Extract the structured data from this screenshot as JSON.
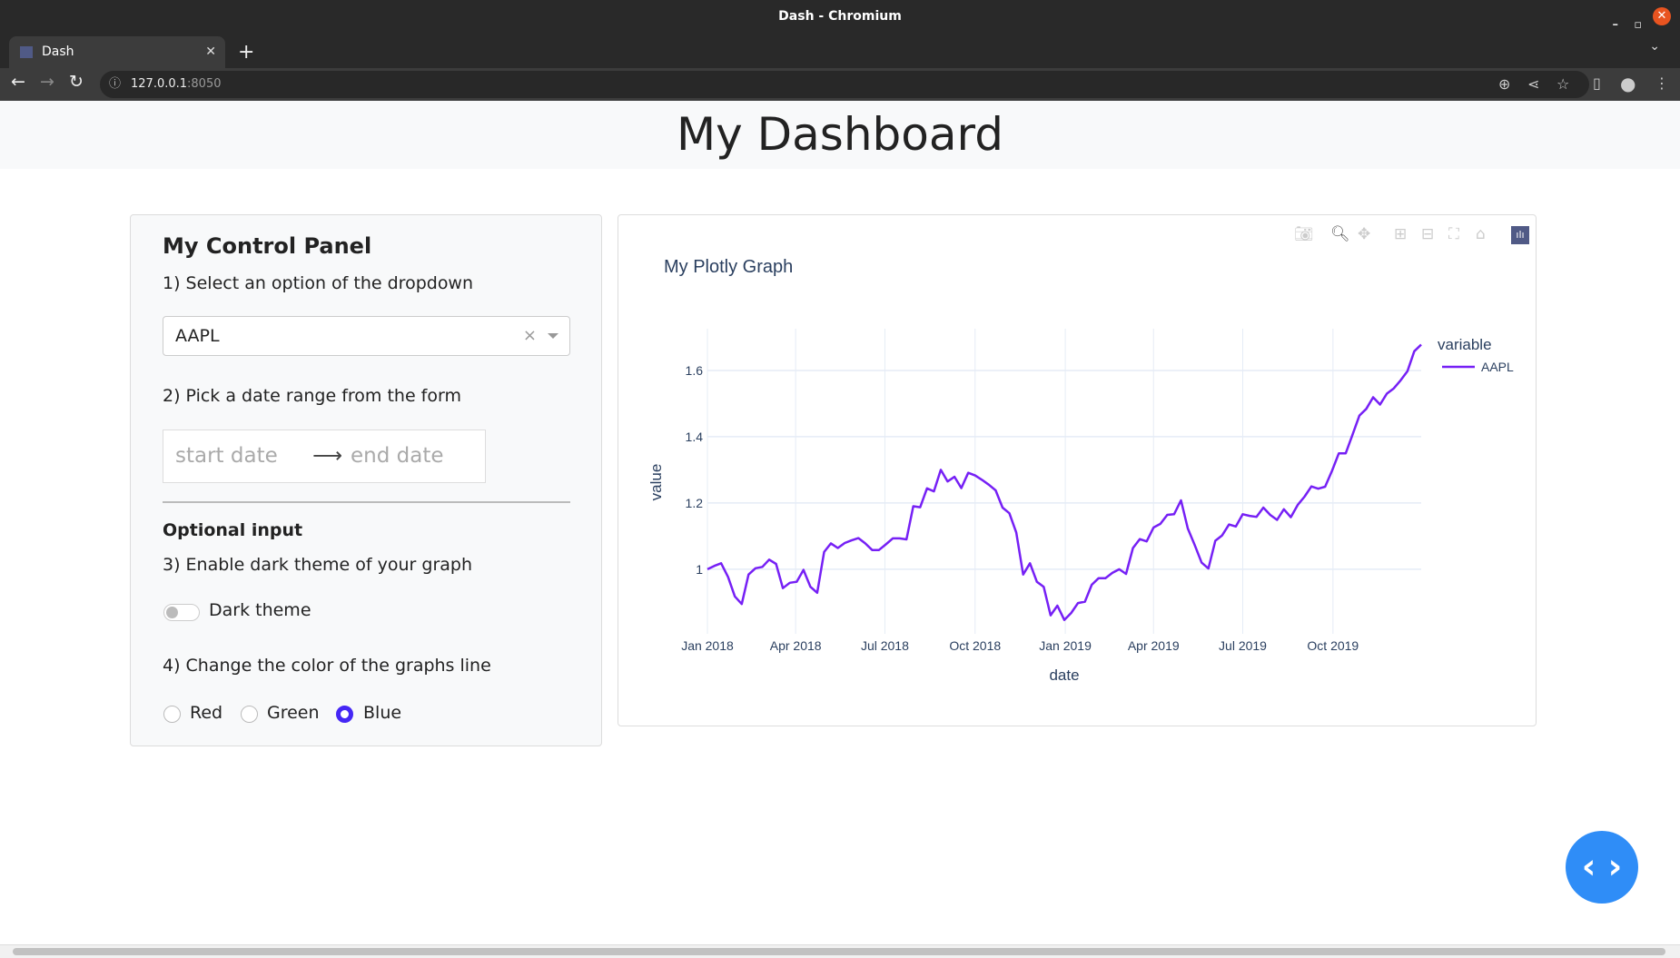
{
  "window": {
    "title": "Dash - Chromium",
    "tab_label": "Dash",
    "url_host": "127.0.0.1",
    "url_port": ":8050"
  },
  "header": {
    "title": "My Dashboard"
  },
  "panel": {
    "title": "My Control Panel",
    "step1": "1) Select an option of the dropdown",
    "dropdown_value": "AAPL",
    "step2": "2) Pick a date range from the form",
    "start_placeholder": "start date",
    "end_placeholder": "end date",
    "optional": "Optional input",
    "step3": "3) Enable dark theme of your graph",
    "toggle_label": "Dark theme",
    "toggle_on": false,
    "step4": "4) Change the color of the graphs line",
    "radios": [
      {
        "label": "Red",
        "checked": false
      },
      {
        "label": "Green",
        "checked": false
      },
      {
        "label": "Blue",
        "checked": true
      }
    ]
  },
  "chart_data": {
    "type": "line",
    "title": "My Plotly Graph",
    "xlabel": "date",
    "ylabel": "value",
    "legend_title": "variable",
    "legend_placement": "top-right",
    "series": [
      {
        "name": "AAPL",
        "color": "#7620f5",
        "start": "2018-01-01",
        "frequency_days": 7,
        "values": [
          1.0,
          1.01,
          1.018,
          0.977,
          0.918,
          0.895,
          0.984,
          1.003,
          1.007,
          1.029,
          1.016,
          0.943,
          0.959,
          0.962,
          0.998,
          0.947,
          0.929,
          1.052,
          1.078,
          1.064,
          1.079,
          1.087,
          1.094,
          1.078,
          1.058,
          1.058,
          1.075,
          1.093,
          1.093,
          1.09,
          1.19,
          1.187,
          1.244,
          1.235,
          1.3,
          1.265,
          1.279,
          1.245,
          1.291,
          1.283,
          1.27,
          1.255,
          1.238,
          1.186,
          1.169,
          1.111,
          0.984,
          1.018,
          0.962,
          0.947,
          0.861,
          0.89,
          0.847,
          0.868,
          0.898,
          0.902,
          0.953,
          0.973,
          0.973,
          0.989,
          1.0,
          0.986,
          1.064,
          1.091,
          1.084,
          1.126,
          1.137,
          1.164,
          1.166,
          1.208,
          1.123,
          1.073,
          1.02,
          1.002,
          1.086,
          1.102,
          1.135,
          1.129,
          1.166,
          1.161,
          1.158,
          1.186,
          1.164,
          1.149,
          1.181,
          1.157,
          1.194,
          1.219,
          1.25,
          1.243,
          1.249,
          1.297,
          1.35,
          1.35,
          1.406,
          1.464,
          1.484,
          1.519,
          1.497,
          1.53,
          1.546,
          1.57,
          1.598,
          1.658,
          1.678
        ]
      }
    ],
    "ylim": [
      0.805,
      1.726
    ],
    "xlim": [
      "2018-01-01",
      "2019-12-30"
    ],
    "yticks": [
      {
        "v": 1,
        "label": "1"
      },
      {
        "v": 1.2,
        "label": "1.2"
      },
      {
        "v": 1.4,
        "label": "1.4"
      },
      {
        "v": 1.6,
        "label": "1.6"
      }
    ],
    "xticks": [
      {
        "d": "2018-01-01",
        "label": "Jan 2018"
      },
      {
        "d": "2018-04-01",
        "label": "Apr 2018"
      },
      {
        "d": "2018-07-01",
        "label": "Jul 2018"
      },
      {
        "d": "2018-10-01",
        "label": "Oct 2018"
      },
      {
        "d": "2019-01-01",
        "label": "Jan 2019"
      },
      {
        "d": "2019-04-01",
        "label": "Apr 2019"
      },
      {
        "d": "2019-07-01",
        "label": "Jul 2019"
      },
      {
        "d": "2019-10-01",
        "label": "Oct 2019"
      }
    ],
    "grid": true
  },
  "modebar": [
    "camera-icon",
    "zoom-icon",
    "pan-icon",
    "zoom-in-icon",
    "zoom-out-icon",
    "autoscale-icon",
    "reset-axes-icon",
    "plotly-logo-icon"
  ],
  "debug": {
    "code_button": "‹ ›"
  }
}
